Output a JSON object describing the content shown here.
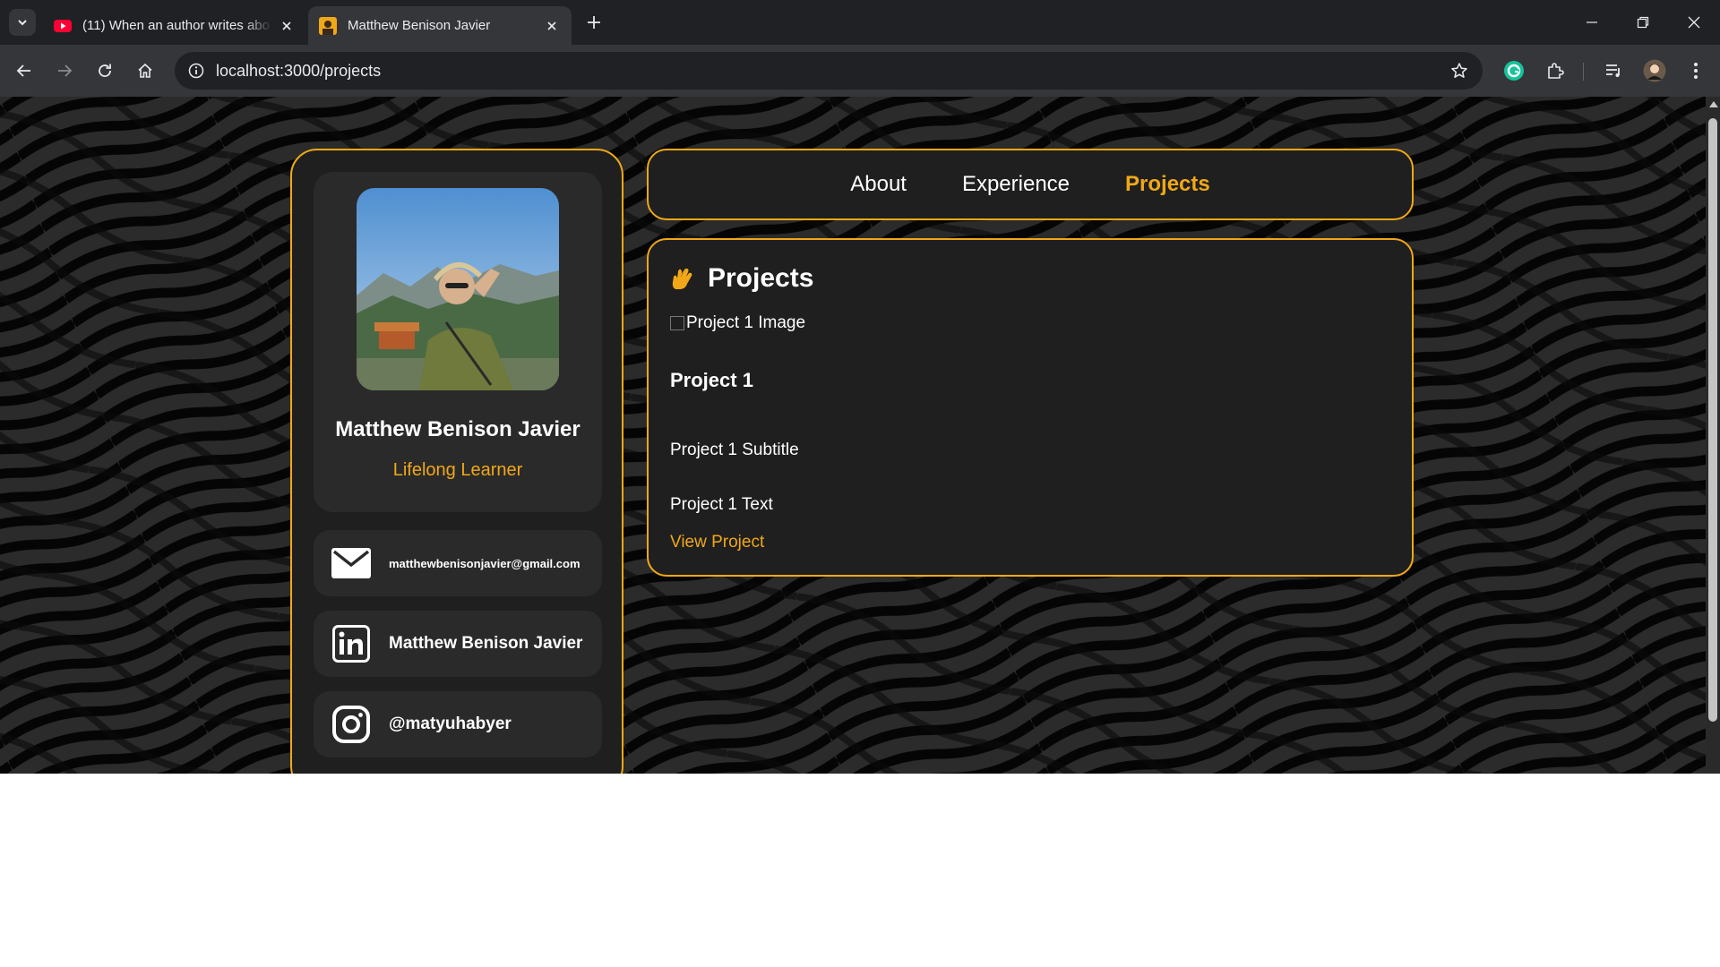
{
  "browser": {
    "tabs": [
      {
        "title": "(11) When an author writes abo",
        "favicon": "youtube-icon",
        "active": false
      },
      {
        "title": "Matthew Benison Javier",
        "favicon": "site-avatar-icon",
        "active": true
      }
    ],
    "url": "localhost:3000/projects"
  },
  "profile": {
    "name": "Matthew Benison Javier",
    "role": "Lifelong Learner",
    "contacts": [
      {
        "icon": "mail-icon",
        "text": "matthewbenisonjavier@gmail.com"
      },
      {
        "icon": "linkedin-icon",
        "text": "Matthew Benison Javier"
      },
      {
        "icon": "instagram-icon",
        "text": "@matyuhabyer"
      }
    ]
  },
  "nav": {
    "links": [
      "About",
      "Experience",
      "Projects"
    ],
    "active": "Projects"
  },
  "projects": {
    "heading": "Projects",
    "heading_icon": "hand-icon",
    "items": [
      {
        "image_alt": "Project 1 Image",
        "title": "Project 1",
        "subtitle": "Project 1 Subtitle",
        "text": "Project 1 Text",
        "link_label": "View Project"
      }
    ]
  },
  "colors": {
    "accent": "#f0a818",
    "panel": "#1f1f1f",
    "card": "#2a2a2a",
    "chrome_dark": "#202124",
    "chrome_toolbar": "#35363a"
  }
}
